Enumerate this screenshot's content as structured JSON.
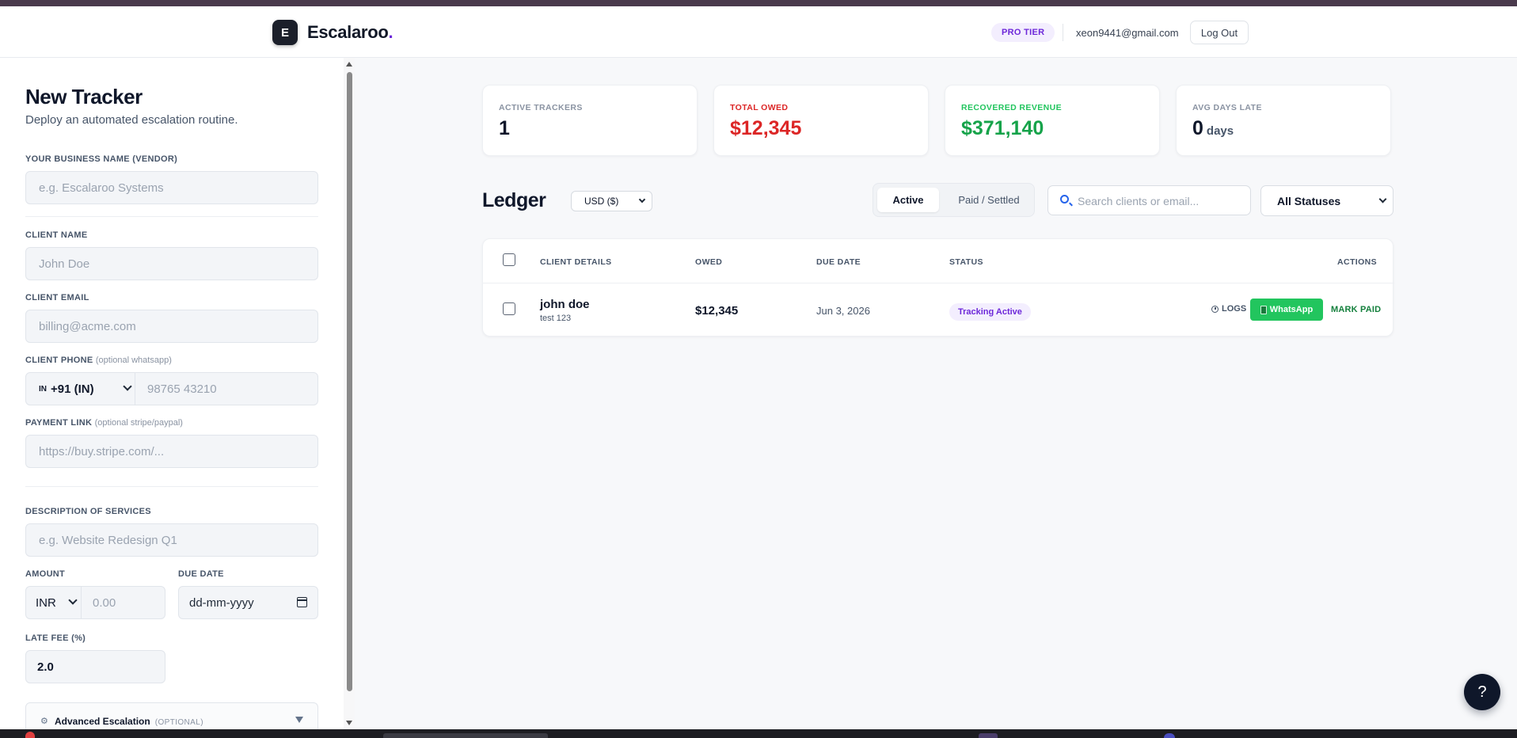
{
  "brand": {
    "logo_letter": "E",
    "name": "Escalaroo",
    "dot": "."
  },
  "header": {
    "tier_badge": "PRO TIER",
    "user_email": "xeon9441@gmail.com",
    "logout_label": "Log Out"
  },
  "form": {
    "title": "New Tracker",
    "subtitle": "Deploy an automated escalation routine.",
    "business_label": "YOUR BUSINESS NAME (VENDOR)",
    "business_placeholder": "e.g. Escalaroo Systems",
    "client_name_label": "CLIENT NAME",
    "client_name_placeholder": "John Doe",
    "client_email_label": "CLIENT EMAIL",
    "client_email_placeholder": "billing@acme.com",
    "phone_label": "CLIENT PHONE",
    "phone_optional": "(optional whatsapp)",
    "phone_flag_code": "IN",
    "phone_country": "+91 (IN)",
    "phone_placeholder": "98765 43210",
    "payment_label": "PAYMENT LINK",
    "payment_optional": "(optional stripe/paypal)",
    "payment_placeholder": "https://buy.stripe.com/...",
    "description_label": "DESCRIPTION OF SERVICES",
    "description_placeholder": "e.g. Website Redesign Q1",
    "amount_label": "AMOUNT",
    "amount_currency": "INR",
    "amount_placeholder": "0.00",
    "due_date_label": "DUE DATE",
    "due_date_placeholder": "dd-mm-yyyy",
    "late_fee_label": "LATE FEE (%)",
    "late_fee_value": "2.0",
    "advanced_label": "Advanced Escalation",
    "advanced_optional": "(OPTIONAL)"
  },
  "stats": [
    {
      "label": "ACTIVE TRACKERS",
      "value": "1",
      "unit": "",
      "color": "#0f172a",
      "label_color": "#8a93a2"
    },
    {
      "label": "TOTAL OWED",
      "value": "$12,345",
      "unit": "",
      "color": "#dc2626",
      "label_color": "#dc2626"
    },
    {
      "label": "RECOVERED REVENUE",
      "value": "$371,140",
      "unit": "",
      "color": "#16a34a",
      "label_color": "#22c55e"
    },
    {
      "label": "AVG DAYS LATE",
      "value": "0",
      "unit": "days",
      "color": "#0f172a",
      "label_color": "#8a93a2"
    }
  ],
  "ledger": {
    "title": "Ledger",
    "currency_select": "USD ($)",
    "tab_active": "Active",
    "tab_paid": "Paid / Settled",
    "search_placeholder": "Search clients or email...",
    "status_filter": "All Statuses",
    "columns": {
      "client": "CLIENT DETAILS",
      "owed": "OWED",
      "due": "DUE DATE",
      "status": "STATUS",
      "actions": "ACTIONS"
    },
    "rows": [
      {
        "name": "john doe",
        "description": "test 123",
        "owed": "$12,345",
        "due_date": "Jun 3, 2026",
        "status": "Tracking Active",
        "logs_label": "LOGS",
        "whatsapp_label": "WhatsApp",
        "mark_paid_label": "MARK PAID"
      }
    ]
  },
  "help_label": "?"
}
